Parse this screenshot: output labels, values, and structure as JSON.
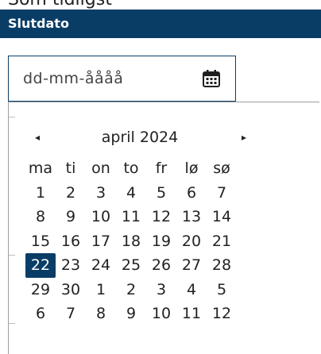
{
  "top_text": "Som tidligst",
  "field": {
    "label": "Slutdato",
    "placeholder": "dd-mm-åååå"
  },
  "calendar": {
    "month_label": "april 2024",
    "prev_symbol": "◂",
    "next_symbol": "▸",
    "weekdays": [
      "ma",
      "ti",
      "on",
      "to",
      "fr",
      "lø",
      "sø"
    ],
    "weeks": [
      [
        "1",
        "2",
        "3",
        "4",
        "5",
        "6",
        "7"
      ],
      [
        "8",
        "9",
        "10",
        "11",
        "12",
        "13",
        "14"
      ],
      [
        "15",
        "16",
        "17",
        "18",
        "19",
        "20",
        "21"
      ],
      [
        "22",
        "23",
        "24",
        "25",
        "26",
        "27",
        "28"
      ],
      [
        "29",
        "30",
        "1",
        "2",
        "3",
        "4",
        "5"
      ],
      [
        "6",
        "7",
        "8",
        "9",
        "10",
        "11",
        "12"
      ]
    ],
    "selected_day": "22"
  },
  "colors": {
    "accent": "#0a3d66"
  },
  "icons": {
    "calendar": "calendar-icon"
  }
}
